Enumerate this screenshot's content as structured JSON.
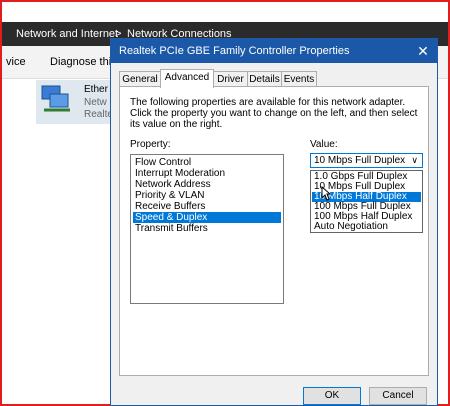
{
  "background_window": {
    "breadcrumb": [
      "Network and Internet",
      "Network Connections"
    ],
    "breadcrumb_separator": ">",
    "toolbar": [
      "vice",
      "Diagnose this"
    ],
    "adapter_lines": [
      "Ether",
      "Netw",
      "Realte"
    ]
  },
  "dialog": {
    "title": "Realtek PCIe GBE Family Controller Properties",
    "close_glyph": "✕",
    "tabs": [
      "General",
      "Advanced",
      "Driver",
      "Details",
      "Events"
    ],
    "active_tab": "Advanced",
    "description": "The following properties are available for this network adapter. Click the property you want to change on the left, and then select its value on the right.",
    "property_label": "Property:",
    "value_label": "Value:",
    "properties": [
      "Flow Control",
      "Interrupt Moderation",
      "Network Address",
      "Priority & VLAN",
      "Receive Buffers",
      "Speed & Duplex",
      "Transmit Buffers"
    ],
    "selected_property": "Speed & Duplex",
    "value_selected": "10 Mbps Full Duplex",
    "value_options": [
      "1.0 Gbps Full Duplex",
      "10 Mbps Full Duplex",
      "10 Mbps Half Duplex",
      "100 Mbps Full Duplex",
      "100 Mbps Half Duplex",
      "Auto Negotiation"
    ],
    "highlighted_option": "10 Mbps Half Duplex",
    "buttons": {
      "ok": "OK",
      "cancel": "Cancel"
    }
  },
  "colors": {
    "accent": "#0078d7",
    "titlebar": "#1b59a8",
    "frame": "#e11d1d"
  }
}
